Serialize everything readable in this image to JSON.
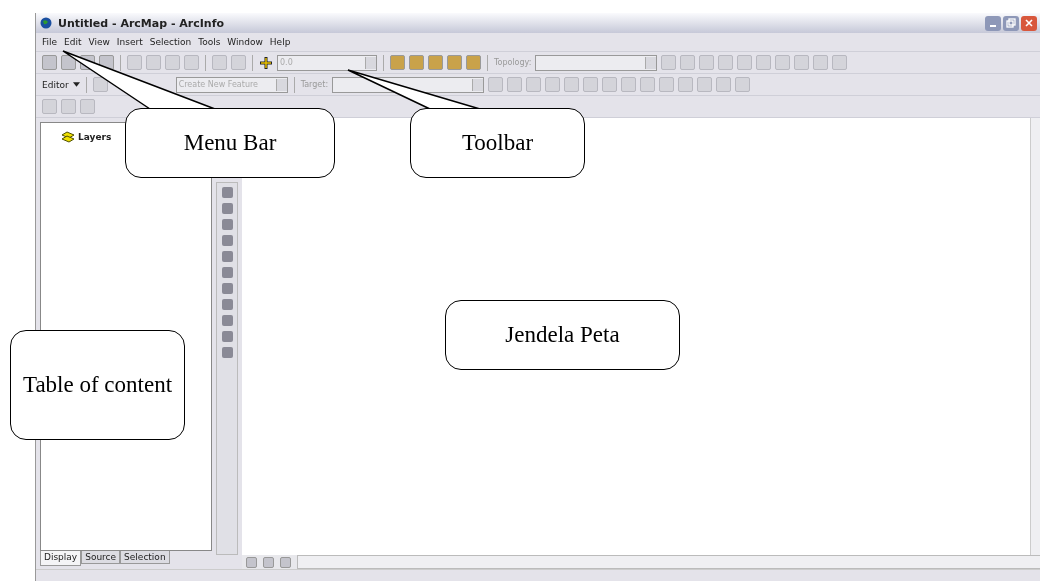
{
  "window": {
    "title": "Untitled - ArcMap - ArcInfo"
  },
  "menu_bar": [
    "File",
    "Edit",
    "View",
    "Insert",
    "Selection",
    "Tools",
    "Window",
    "Help"
  ],
  "toolbar": {
    "scale_field": "0.0",
    "topology_label": "Topology:"
  },
  "editor_toolbar": {
    "editor_menu": "Editor",
    "task_field": "Create New Feature",
    "target_label": "Target:"
  },
  "table_of_contents": {
    "root": "Layers",
    "tabs": [
      {
        "label": "Display",
        "selected": true
      },
      {
        "label": "Source",
        "selected": false
      },
      {
        "label": "Selection",
        "selected": false
      }
    ]
  },
  "callouts": [
    {
      "text": "Menu Bar",
      "kind": "menu"
    },
    {
      "text": "Toolbar",
      "kind": "toolbar"
    },
    {
      "text": "Jendela Peta",
      "kind": "map"
    },
    {
      "text": "Table of content",
      "kind": "toc"
    }
  ]
}
